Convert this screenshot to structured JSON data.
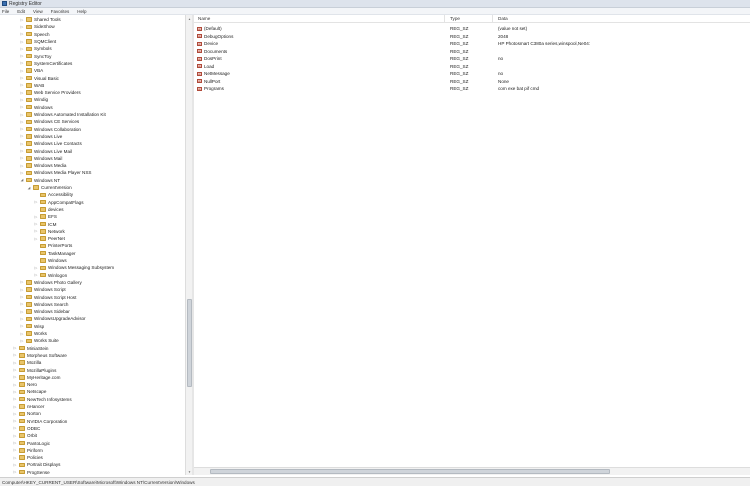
{
  "window": {
    "title": "Registry Editor"
  },
  "menu": [
    "File",
    "Edit",
    "View",
    "Favorites",
    "Help"
  ],
  "tree": [
    {
      "label": "Shared Tools",
      "depth": 3,
      "expander": "collapsed"
    },
    {
      "label": "SideShow",
      "depth": 3,
      "expander": "collapsed"
    },
    {
      "label": "Speech",
      "depth": 3,
      "expander": "collapsed"
    },
    {
      "label": "SQMClient",
      "depth": 3,
      "expander": "collapsed"
    },
    {
      "label": "Symbols",
      "depth": 3,
      "expander": "collapsed"
    },
    {
      "label": "SyncToy",
      "depth": 3,
      "expander": "collapsed"
    },
    {
      "label": "SystemCertificates",
      "depth": 3,
      "expander": "collapsed"
    },
    {
      "label": "VBA",
      "depth": 3,
      "expander": "collapsed"
    },
    {
      "label": "Visual Basic",
      "depth": 3,
      "expander": "collapsed"
    },
    {
      "label": "WAB",
      "depth": 3,
      "expander": "collapsed"
    },
    {
      "label": "Web Service Providers",
      "depth": 3,
      "expander": "collapsed"
    },
    {
      "label": "Windig",
      "depth": 3,
      "expander": "collapsed"
    },
    {
      "label": "Windows",
      "depth": 3,
      "expander": "collapsed"
    },
    {
      "label": "Windows Automated Installation Kit",
      "depth": 3,
      "expander": "collapsed"
    },
    {
      "label": "Windows CE Services",
      "depth": 3,
      "expander": "collapsed"
    },
    {
      "label": "Windows Collaboration",
      "depth": 3,
      "expander": "collapsed"
    },
    {
      "label": "Windows Live",
      "depth": 3,
      "expander": "collapsed"
    },
    {
      "label": "Windows Live Contacts",
      "depth": 3,
      "expander": "collapsed"
    },
    {
      "label": "Windows Live Mail",
      "depth": 3,
      "expander": "collapsed"
    },
    {
      "label": "Windows Mail",
      "depth": 3,
      "expander": "collapsed"
    },
    {
      "label": "Windows Media",
      "depth": 3,
      "expander": "collapsed"
    },
    {
      "label": "Windows Media Player NSS",
      "depth": 3,
      "expander": "collapsed"
    },
    {
      "label": "Windows NT",
      "depth": 3,
      "expander": "expanded"
    },
    {
      "label": "CurrentVersion",
      "depth": 4,
      "expander": "expanded"
    },
    {
      "label": "Accessibility",
      "depth": 5,
      "expander": "none"
    },
    {
      "label": "AppCompatFlags",
      "depth": 5,
      "expander": "collapsed"
    },
    {
      "label": "devices",
      "depth": 5,
      "expander": "none"
    },
    {
      "label": "EFS",
      "depth": 5,
      "expander": "collapsed"
    },
    {
      "label": "ICM",
      "depth": 5,
      "expander": "collapsed"
    },
    {
      "label": "Network",
      "depth": 5,
      "expander": "collapsed"
    },
    {
      "label": "PeerNet",
      "depth": 5,
      "expander": "collapsed"
    },
    {
      "label": "PrinterPorts",
      "depth": 5,
      "expander": "none"
    },
    {
      "label": "TaskManager",
      "depth": 5,
      "expander": "none"
    },
    {
      "label": "Windows",
      "depth": 5,
      "expander": "none"
    },
    {
      "label": "Windows Messaging Subsystem",
      "depth": 5,
      "expander": "collapsed"
    },
    {
      "label": "Winlogon",
      "depth": 5,
      "expander": "collapsed"
    },
    {
      "label": "Windows Photo Gallery",
      "depth": 3,
      "expander": "collapsed"
    },
    {
      "label": "Windows Script",
      "depth": 3,
      "expander": "collapsed"
    },
    {
      "label": "Windows Script Host",
      "depth": 3,
      "expander": "collapsed"
    },
    {
      "label": "Windows Search",
      "depth": 3,
      "expander": "collapsed"
    },
    {
      "label": "Windows Sidebar",
      "depth": 3,
      "expander": "collapsed"
    },
    {
      "label": "WindowsUpgradeAdvisor",
      "depth": 3,
      "expander": "collapsed"
    },
    {
      "label": "Wisp",
      "depth": 3,
      "expander": "collapsed"
    },
    {
      "label": "Works",
      "depth": 3,
      "expander": "collapsed"
    },
    {
      "label": "Works Suite",
      "depth": 3,
      "expander": "collapsed"
    },
    {
      "label": "MiniaStein",
      "depth": 2,
      "expander": "collapsed"
    },
    {
      "label": "Morpheus Software",
      "depth": 2,
      "expander": "collapsed"
    },
    {
      "label": "Mozilla",
      "depth": 2,
      "expander": "collapsed"
    },
    {
      "label": "MozillaPlugins",
      "depth": 2,
      "expander": "collapsed"
    },
    {
      "label": "MyHeritage.com",
      "depth": 2,
      "expander": "collapsed"
    },
    {
      "label": "Nero",
      "depth": 2,
      "expander": "collapsed"
    },
    {
      "label": "Netscape",
      "depth": 2,
      "expander": "collapsed"
    },
    {
      "label": "NewTech Infosystems",
      "depth": 2,
      "expander": "collapsed"
    },
    {
      "label": "nHancer",
      "depth": 2,
      "expander": "collapsed"
    },
    {
      "label": "Norton",
      "depth": 2,
      "expander": "collapsed"
    },
    {
      "label": "NVIDIA Corporation",
      "depth": 2,
      "expander": "collapsed"
    },
    {
      "label": "ODBC",
      "depth": 2,
      "expander": "collapsed"
    },
    {
      "label": "Orbit",
      "depth": 2,
      "expander": "collapsed"
    },
    {
      "label": "PantoLogic",
      "depth": 2,
      "expander": "collapsed"
    },
    {
      "label": "Piriform",
      "depth": 2,
      "expander": "collapsed"
    },
    {
      "label": "Policies",
      "depth": 2,
      "expander": "collapsed"
    },
    {
      "label": "Portrait Displays",
      "depth": 2,
      "expander": "collapsed"
    },
    {
      "label": "ProgSense",
      "depth": 2,
      "expander": "collapsed"
    }
  ],
  "list": {
    "headers": {
      "name": "Name",
      "type": "Type",
      "data": "Data"
    },
    "rows": [
      {
        "name": "(Default)",
        "type": "REG_SZ",
        "data": "(value not set)"
      },
      {
        "name": "DebugOptions",
        "type": "REG_SZ",
        "data": "2048"
      },
      {
        "name": "Device",
        "type": "REG_SZ",
        "data": "HP Photosmart C380a series,winspool,Ne04:"
      },
      {
        "name": "Documents",
        "type": "REG_SZ",
        "data": ""
      },
      {
        "name": "DosPrint",
        "type": "REG_SZ",
        "data": "no"
      },
      {
        "name": "Load",
        "type": "REG_SZ",
        "data": ""
      },
      {
        "name": "NetMessage",
        "type": "REG_SZ",
        "data": "no"
      },
      {
        "name": "NullPort",
        "type": "REG_SZ",
        "data": "None"
      },
      {
        "name": "Programs",
        "type": "REG_SZ",
        "data": "com exe bat pif cmd"
      }
    ]
  },
  "status": {
    "path": "Computer\\HKEY_CURRENT_USER\\Software\\Microsoft\\Windows NT\\CurrentVersion\\Windows"
  },
  "colors": {
    "folder": "#e9c46a",
    "value_icon": "#b04a3a"
  }
}
